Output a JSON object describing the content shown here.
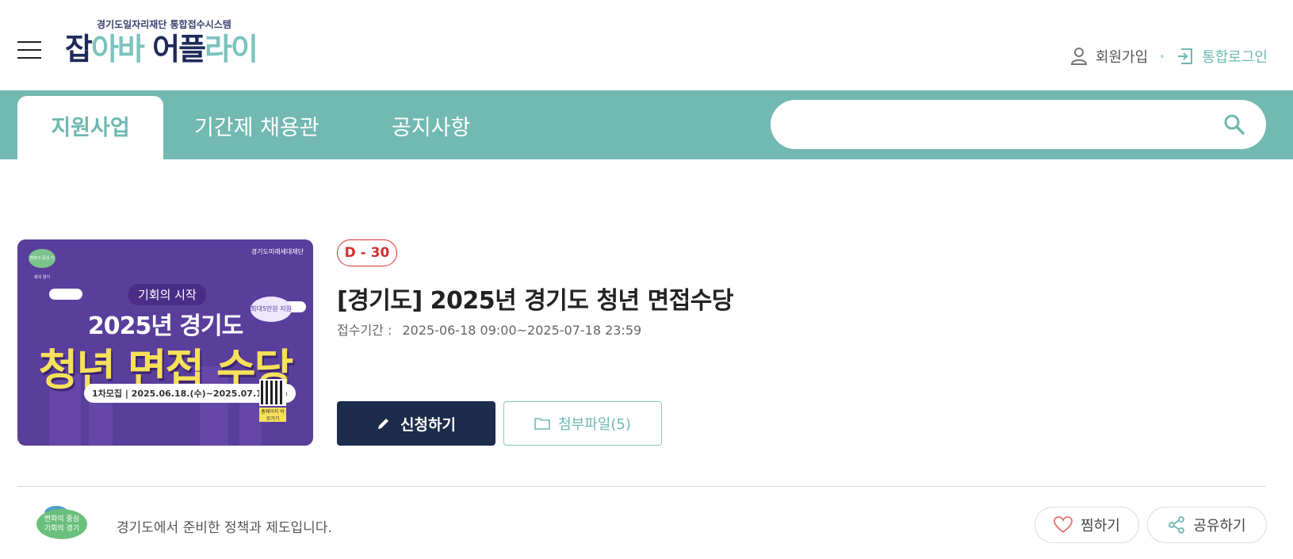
{
  "header": {
    "logo_sub": "경기도일자리재단 통합접수시스템",
    "logo_main_part1": "잡",
    "logo_main_part2": "아바",
    "logo_main_part3": " 어플",
    "logo_main_part4": "라이",
    "join_label": "회원가입",
    "login_label": "통합로그인"
  },
  "nav": {
    "tabs": [
      {
        "label": "지원사업",
        "active": true
      },
      {
        "label": "기간제 채용관",
        "active": false
      },
      {
        "label": "공지사항",
        "active": false
      }
    ],
    "search_placeholder": ""
  },
  "program": {
    "dday": "D - 30",
    "title": "[경기도] 2025년 경기도 청년 면접수당",
    "period_label": "접수기간 :",
    "period_value": "2025-06-18 09:00~2025-07-18 23:59",
    "apply_label": "신청하기",
    "attachments_label": "첨부파일(5)"
  },
  "thumbnail": {
    "org": "경기도미래세대재단",
    "pill": "기회의 시작",
    "line1": "2025년 경기도",
    "line2": "청년 면접 수당",
    "period": "1차모집 | 2025.06.18.(수)~2025.07.18.(금)",
    "bubble": "최대5만원 지원",
    "qr_label": "홈페이지 바로가기",
    "badge": "변화의 중심 기회의 경기"
  },
  "footer": {
    "logo_text_1": "변화의 중심",
    "logo_text_2": "기회의 경기",
    "description": "경기도에서 준비한 정책과 제도입니다.",
    "like_label": "찜하기",
    "share_label": "공유하기"
  },
  "colors": {
    "teal": "#72b9b2",
    "navy": "#1d2b4c",
    "dday_red": "#d32f2f"
  }
}
